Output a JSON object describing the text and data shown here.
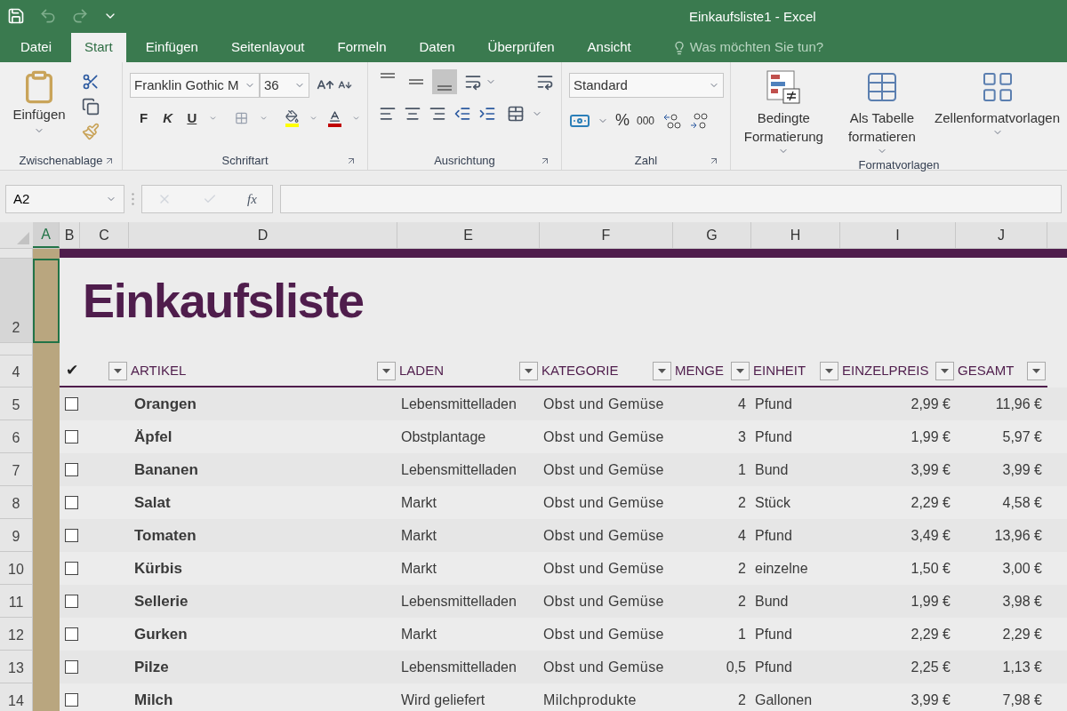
{
  "title_bar": {
    "title": "Einkaufsliste1 - Excel"
  },
  "ribbon_tabs": [
    {
      "label": "Datei",
      "selected": false
    },
    {
      "label": "Start",
      "selected": true
    },
    {
      "label": "Einfügen",
      "selected": false
    },
    {
      "label": "Seitenlayout",
      "selected": false
    },
    {
      "label": "Formeln",
      "selected": false
    },
    {
      "label": "Daten",
      "selected": false
    },
    {
      "label": "Überprüfen",
      "selected": false
    },
    {
      "label": "Ansicht",
      "selected": false
    }
  ],
  "tell_me": {
    "placeholder": "Was möchten Sie tun?"
  },
  "clipboard": {
    "paste_label": "Einfügen",
    "group_label": "Zwischenablage"
  },
  "font": {
    "font_name": "Franklin Gothic M",
    "font_size": "36",
    "style_buttons": [
      {
        "label": "F",
        "kind": "bold"
      },
      {
        "label": "K",
        "kind": "italic"
      },
      {
        "label": "U",
        "kind": "underline"
      }
    ],
    "group_label": "Schriftart"
  },
  "alignment": {
    "vertical": [
      {
        "kind": "top",
        "selected": false
      },
      {
        "kind": "middle",
        "selected": false
      },
      {
        "kind": "bottom",
        "selected": true
      }
    ],
    "group_label": "Ausrichtung"
  },
  "number": {
    "format": "Standard",
    "percent": "%",
    "thousands": "000",
    "group_label": "Zahl"
  },
  "styles": {
    "buttons": [
      {
        "label": "Bedingte Formatierung",
        "kind": "conditional"
      },
      {
        "label": "Als Tabelle formatieren",
        "kind": "table"
      },
      {
        "label": "Zellenformatvorlagen",
        "kind": "cell"
      }
    ],
    "group_label": "Formatvorlagen"
  },
  "formula_bar": {
    "name_box": "A2",
    "fx": "fx"
  },
  "column_headers": [
    {
      "label": "A",
      "selected": true
    },
    {
      "label": "B",
      "selected": false
    },
    {
      "label": "C",
      "selected": false
    },
    {
      "label": "D",
      "selected": false
    },
    {
      "label": "E",
      "selected": false
    },
    {
      "label": "F",
      "selected": false
    },
    {
      "label": "G",
      "selected": false
    },
    {
      "label": "H",
      "selected": false
    },
    {
      "label": "I",
      "selected": false
    },
    {
      "label": "J",
      "selected": false
    }
  ],
  "sheet": {
    "title_row": "2",
    "title": "Einkaufsliste",
    "header_row": "4",
    "check_header": "✔",
    "columns": [
      {
        "label": "ARTIKEL"
      },
      {
        "label": "LADEN"
      },
      {
        "label": "KATEGORIE"
      },
      {
        "label": "MENGE"
      },
      {
        "label": "EINHEIT"
      },
      {
        "label": "EINZELPREIS"
      },
      {
        "label": "GESAMT"
      }
    ],
    "rows": [
      {
        "row_number": "5",
        "checked": false,
        "cells": [
          "Orangen",
          "Lebensmittelladen",
          "Obst und Gemüse",
          "4",
          "Pfund",
          "2,99 €",
          "11,96 €"
        ]
      },
      {
        "row_number": "6",
        "checked": false,
        "cells": [
          "Äpfel",
          "Obstplantage",
          "Obst und Gemüse",
          "3",
          "Pfund",
          "1,99 €",
          "5,97 €"
        ]
      },
      {
        "row_number": "7",
        "checked": false,
        "cells": [
          "Bananen",
          "Lebensmittelladen",
          "Obst und Gemüse",
          "1",
          "Bund",
          "3,99 €",
          "3,99 €"
        ]
      },
      {
        "row_number": "8",
        "checked": false,
        "cells": [
          "Salat",
          "Markt",
          "Obst und Gemüse",
          "2",
          "Stück",
          "2,29 €",
          "4,58 €"
        ]
      },
      {
        "row_number": "9",
        "checked": false,
        "cells": [
          "Tomaten",
          "Markt",
          "Obst und Gemüse",
          "4",
          "Pfund",
          "3,49 €",
          "13,96 €"
        ]
      },
      {
        "row_number": "10",
        "checked": false,
        "cells": [
          "Kürbis",
          "Markt",
          "Obst und Gemüse",
          "2",
          "einzelne",
          "1,50 €",
          "3,00 €"
        ]
      },
      {
        "row_number": "11",
        "checked": false,
        "cells": [
          "Sellerie",
          "Lebensmittelladen",
          "Obst und Gemüse",
          "2",
          "Bund",
          "1,99 €",
          "3,98 €"
        ]
      },
      {
        "row_number": "12",
        "checked": false,
        "cells": [
          "Gurken",
          "Markt",
          "Obst und Gemüse",
          "1",
          "Pfund",
          "2,29 €",
          "2,29 €"
        ]
      },
      {
        "row_number": "13",
        "checked": false,
        "cells": [
          "Pilze",
          "Lebensmittelladen",
          "Obst und Gemüse",
          "0,5",
          "Pfund",
          "2,25 €",
          "1,13 €"
        ]
      },
      {
        "row_number": "14",
        "checked": false,
        "cells": [
          "Milch",
          "Wird geliefert",
          "Milchprodukte",
          "2",
          "Gallonen",
          "3,99 €",
          "7,98 €"
        ]
      }
    ]
  }
}
